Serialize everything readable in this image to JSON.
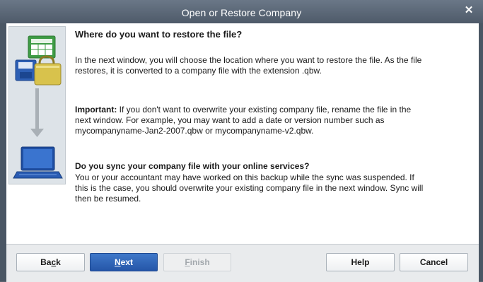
{
  "window": {
    "title": "Open or Restore Company"
  },
  "content": {
    "heading": "Where do you want to restore the file?",
    "paragraph1": "In the next window, you will choose the location where you want to restore the file. As the file restores, it is converted to a company file with the extension .qbw.",
    "important_label": "Important:",
    "important_text": " If you don't want to overwrite your existing company file, rename the file in the next window. For example, you may want to add a date or version number such as mycompanyname-Jan2-2007.qbw or mycompanyname-v2.qbw.",
    "sync_question": "Do you sync your company file with your online services?",
    "sync_text": "You or your accountant may have worked on this backup while the sync was suspended. If this is the case, you should overwrite your existing company file in the next window. Sync will then be resumed."
  },
  "buttons": {
    "back_pre": "Ba",
    "back_ul": "c",
    "back_post": "k",
    "next_pre": "",
    "next_ul": "N",
    "next_post": "ext",
    "finish_pre": "",
    "finish_ul": "F",
    "finish_post": "inish",
    "help": "Help",
    "cancel": "Cancel"
  },
  "icons": {
    "close": "close-icon",
    "illustration": "restore-illustration"
  },
  "colors": {
    "titlebar": "#4e5a69",
    "primary_button": "#2556a8"
  }
}
